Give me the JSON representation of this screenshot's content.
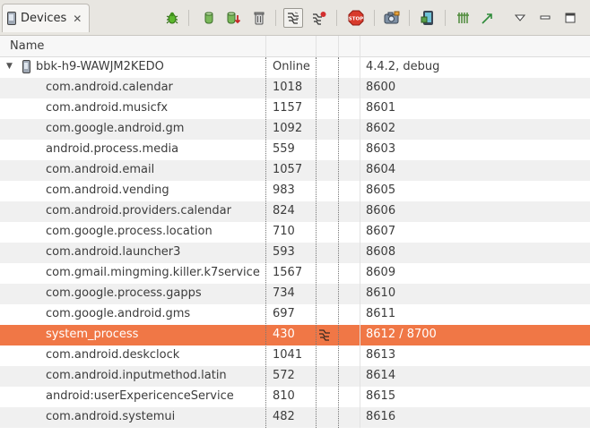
{
  "tab": {
    "label": "Devices",
    "close": "✕"
  },
  "toolbar": {
    "buttons": [
      {
        "name": "debug-process-button",
        "icon": "bug-icon"
      },
      {
        "name": "update-heap-button",
        "icon": "heap-icon"
      },
      {
        "name": "dump-hprof-button",
        "icon": "heap-dump-icon"
      },
      {
        "name": "cause-gc-button",
        "icon": "trash-icon"
      },
      {
        "name": "update-threads-button",
        "icon": "threads-icon"
      },
      {
        "name": "start-method-profiling-button",
        "icon": "profiling-icon"
      },
      {
        "name": "stop-process-button",
        "icon": "stop-icon"
      },
      {
        "name": "screen-capture-button",
        "icon": "camera-icon"
      },
      {
        "name": "dump-view-hierarchy-button",
        "icon": "hierarchy-icon"
      },
      {
        "name": "systrace-button",
        "icon": "systrace-icon"
      },
      {
        "name": "opengl-trace-button",
        "icon": "trace-icon"
      },
      {
        "name": "view-menu-button",
        "icon": "chevron-down-icon"
      },
      {
        "name": "minimize-button",
        "icon": "minimize-icon"
      },
      {
        "name": "maximize-button",
        "icon": "maximize-icon"
      }
    ],
    "stop_text": "STOP"
  },
  "table": {
    "header": {
      "name": "Name"
    },
    "device": {
      "name": "bbk-h9-WAWJM2KEDO",
      "status": "Online",
      "version": "4.4.2, debug"
    },
    "processes": [
      {
        "name": "com.android.calendar",
        "pid": "1018",
        "port": "8600"
      },
      {
        "name": "com.android.musicfx",
        "pid": "1157",
        "port": "8601"
      },
      {
        "name": "com.google.android.gm",
        "pid": "1092",
        "port": "8602"
      },
      {
        "name": "android.process.media",
        "pid": "559",
        "port": "8603"
      },
      {
        "name": "com.android.email",
        "pid": "1057",
        "port": "8604"
      },
      {
        "name": "com.android.vending",
        "pid": "983",
        "port": "8605"
      },
      {
        "name": "com.android.providers.calendar",
        "pid": "824",
        "port": "8606"
      },
      {
        "name": "com.google.process.location",
        "pid": "710",
        "port": "8607"
      },
      {
        "name": "com.android.launcher3",
        "pid": "593",
        "port": "8608"
      },
      {
        "name": "com.gmail.mingming.killer.k7service",
        "pid": "1567",
        "port": "8609"
      },
      {
        "name": "com.google.process.gapps",
        "pid": "734",
        "port": "8610"
      },
      {
        "name": "com.google.android.gms",
        "pid": "697",
        "port": "8611"
      },
      {
        "name": "system_process",
        "pid": "430",
        "port": "8612 / 8700",
        "selected": true,
        "debug_icon": "threads-icon"
      },
      {
        "name": "com.android.deskclock",
        "pid": "1041",
        "port": "8613"
      },
      {
        "name": "com.android.inputmethod.latin",
        "pid": "572",
        "port": "8614"
      },
      {
        "name": "android:userExpericenceService",
        "pid": "810",
        "port": "8615"
      },
      {
        "name": "com.android.systemui",
        "pid": "482",
        "port": "8616"
      }
    ]
  },
  "colors": {
    "selection": "#f07746",
    "stripe": "#f0f0f0"
  }
}
